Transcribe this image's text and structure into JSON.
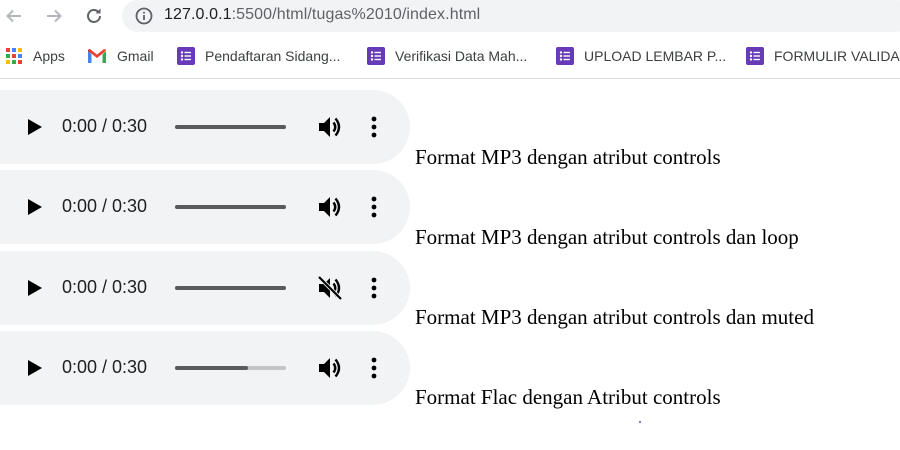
{
  "browser": {
    "back_icon": "arrow-left-icon",
    "forward_icon": "arrow-right-icon",
    "reload_icon": "reload-icon",
    "url_host": "127.0.0.1",
    "url_path": ":5500/html/tugas%2010/index.html"
  },
  "bookmarks": [
    {
      "label": "Apps",
      "icon": "apps-grid-icon"
    },
    {
      "label": "Gmail",
      "icon": "gmail-icon"
    },
    {
      "label": "Pendaftaran Sidang...",
      "icon": "google-forms-icon"
    },
    {
      "label": "Verifikasi Data Mah...",
      "icon": "google-forms-icon"
    },
    {
      "label": "UPLOAD LEMBAR P...",
      "icon": "google-forms-icon"
    },
    {
      "label": "FORMULIR VALIDA",
      "icon": "google-forms-icon"
    }
  ],
  "colors": {
    "player_bg": "#f1f3f4",
    "forms_purple": "#673ab7",
    "track_played": "#5b5b5b",
    "track_unplayed": "#c4c4c4"
  },
  "players": [
    {
      "time": "0:00 / 0:30",
      "muted": false,
      "buffered_fraction": 1.0,
      "caption": "Format MP3 dengan atribut controls"
    },
    {
      "time": "0:00 / 0:30",
      "muted": false,
      "buffered_fraction": 1.0,
      "caption": "Format MP3 dengan atribut controls dan loop"
    },
    {
      "time": "0:00 / 0:30",
      "muted": true,
      "buffered_fraction": 1.0,
      "caption": "Format MP3 dengan atribut controls dan muted"
    },
    {
      "time": "0:00 / 0:30",
      "muted": false,
      "buffered_fraction": 0.66,
      "caption": "Format Flac dengan Atribut controls"
    }
  ]
}
